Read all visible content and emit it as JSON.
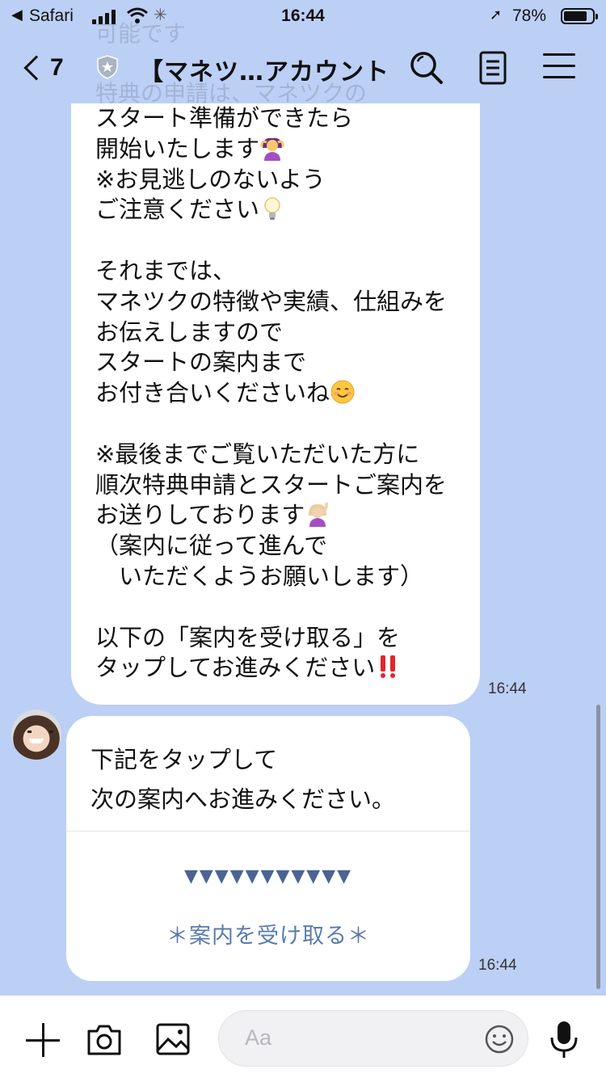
{
  "status_bar": {
    "back_app": "Safari",
    "time": "16:44",
    "battery": "78%"
  },
  "header": {
    "back_count": "7",
    "title": "【マネツ…アカウント"
  },
  "ghost_lines": [
    "可能です",
    "特典の申請は、マネツクの"
  ],
  "message": {
    "lines": [
      "スタート準備ができたら",
      "開始いたします",
      "※お見逃しのないよう",
      "ご注意ください",
      "",
      "それまでは、",
      "マネツクの特徴や実績、仕組みを",
      "お伝えしますので",
      "スタートの案内まで",
      "お付き合いくださいね",
      "",
      "※最後までご覧いただいた方に",
      "順次特典申請とスタートご案内を",
      "お送りしております",
      "（案内に従って進んで",
      "　いただくようお願いします）",
      "",
      "以下の「案内を受け取る」を",
      "タップしてお進みください"
    ],
    "time": "16:44"
  },
  "card": {
    "text_line1": "下記をタップして",
    "text_line2": "次の案内へお進みください。",
    "arrows": "▼▼▼▼▼▼▼▼▼▼▼",
    "link": "＊案内を受け取る＊",
    "time": "16:44"
  },
  "input": {
    "placeholder": "Aa"
  },
  "icons": [
    "back-chevron-icon",
    "shield-icon",
    "search-icon",
    "notes-icon",
    "menu-icon",
    "plus-icon",
    "camera-icon",
    "image-icon",
    "emoji-icon",
    "mic-icon"
  ],
  "colors": {
    "chat_background": "#bccff5",
    "link_color": "#5a7bac",
    "arrow_color": "#4b6493"
  }
}
